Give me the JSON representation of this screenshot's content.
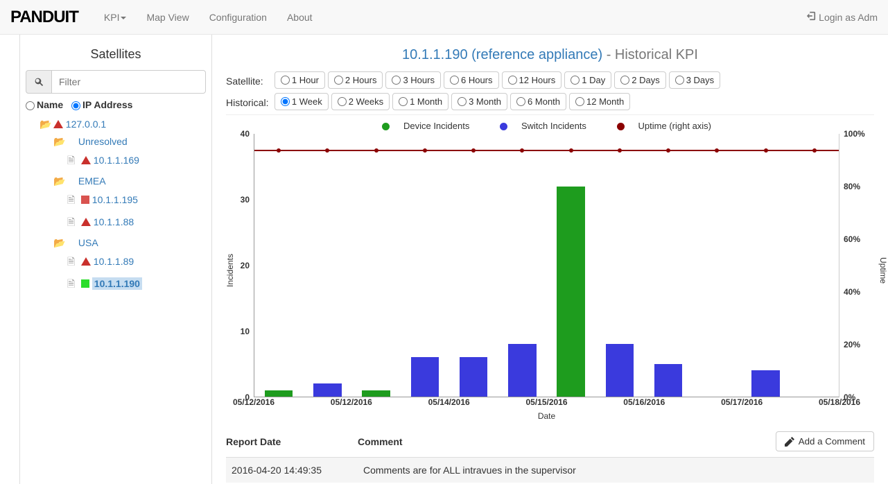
{
  "nav": {
    "brand": "PANDUIT",
    "items": [
      "KPI",
      "Map View",
      "Configuration",
      "About"
    ],
    "login": "Login as Adm"
  },
  "sidebar": {
    "title": "Satellites",
    "filter_placeholder": "Filter",
    "sort": {
      "name_label": "Name",
      "ip_label": "IP Address"
    },
    "tree": {
      "root": "127.0.0.1",
      "groups": [
        {
          "name": "Unresolved",
          "items": [
            {
              "ip": "10.1.1.169",
              "status": "warn"
            }
          ]
        },
        {
          "name": "EMEA",
          "items": [
            {
              "ip": "10.1.1.195",
              "status": "red"
            },
            {
              "ip": "10.1.1.88",
              "status": "warn"
            }
          ]
        },
        {
          "name": "USA",
          "items": [
            {
              "ip": "10.1.1.89",
              "status": "warn"
            },
            {
              "ip": "10.1.1.190",
              "status": "green",
              "selected": true
            }
          ]
        }
      ]
    }
  },
  "header": {
    "link_text": "10.1.1.190 (reference appliance)",
    "static_text": " - Historical KPI"
  },
  "controls": {
    "satellite_label": "Satellite:",
    "historical_label": "Historical:",
    "satellite_opts": [
      "1 Hour",
      "2 Hours",
      "3 Hours",
      "6 Hours",
      "12 Hours",
      "1 Day",
      "2 Days",
      "3 Days"
    ],
    "historical_opts": [
      "1 Week",
      "2 Weeks",
      "1 Month",
      "3 Month",
      "6 Month",
      "12 Month"
    ],
    "historical_selected": "1 Week"
  },
  "chart_data": {
    "type": "bar",
    "title": "",
    "xlabel": "Date",
    "ylabel": "Incidents",
    "ylabel_right": "Uptime",
    "ylim": [
      0,
      40
    ],
    "ylim_right": [
      0,
      100
    ],
    "yticks_left": [
      0,
      10,
      20,
      30,
      40
    ],
    "yticks_right": [
      "0%",
      "20%",
      "40%",
      "60%",
      "80%",
      "100%"
    ],
    "x_tick_labels": [
      "05/12/2016",
      "05/12/2016",
      "05/14/2016",
      "05/15/2016",
      "05/16/2016",
      "05/17/2016",
      "05/18/2016"
    ],
    "series": [
      {
        "name": "Device Incidents",
        "color": "#1e9c1e",
        "values": [
          1,
          0,
          1,
          0,
          0,
          0,
          32,
          0,
          0,
          0,
          0,
          0
        ]
      },
      {
        "name": "Switch Incidents",
        "color": "#3a3add",
        "values": [
          0,
          2,
          0,
          6,
          6,
          8,
          0,
          8,
          5,
          0,
          4,
          0
        ]
      },
      {
        "name": "Uptime (right axis)",
        "color": "#8b0000",
        "type": "line",
        "axis": "right",
        "values": [
          94,
          94,
          94,
          94,
          94,
          94,
          94,
          94,
          94,
          94,
          94,
          94
        ]
      }
    ],
    "legend": [
      "Device Incidents",
      "Switch Incidents",
      "Uptime (right axis)"
    ]
  },
  "comments": {
    "col1": "Report Date",
    "col2": "Comment",
    "add_label": "Add a Comment",
    "rows": [
      {
        "date": "2016-04-20 14:49:35",
        "text": "Comments are for ALL intravues in the supervisor"
      }
    ]
  }
}
